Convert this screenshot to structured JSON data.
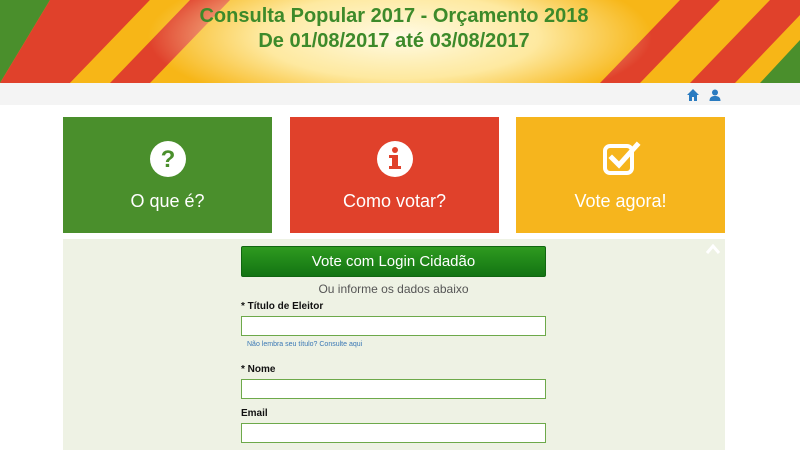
{
  "banner": {
    "title_line1": "Consulta Popular 2017 - Orçamento 2018",
    "title_line2": "De 01/08/2017 até 03/08/2017",
    "colors": {
      "green": "#4a8f2c",
      "red": "#e0412b",
      "yellow": "#f6b51d",
      "title": "#3d8a2a"
    }
  },
  "topbar": {
    "icons": [
      "home-icon",
      "user-icon"
    ]
  },
  "tiles": [
    {
      "icon": "question-icon",
      "label": "O que é?",
      "color": "#4a8f2c"
    },
    {
      "icon": "info-icon",
      "label": "Como votar?",
      "color": "#e0412b"
    },
    {
      "icon": "checkbox-icon",
      "label": "Vote agora!",
      "color": "#f6b51d"
    }
  ],
  "form": {
    "login_button": "Vote com Login Cidadão",
    "subtitle": "Ou informe os dados abaixo",
    "titulo_label": "* Título de Eleitor",
    "titulo_value": "",
    "help_link": "Não lembra seu título? Consulte aqui",
    "nome_label": "* Nome",
    "nome_value": "",
    "email_label": "Email",
    "email_value": "",
    "collapse_icon": "chevron-up-icon"
  }
}
